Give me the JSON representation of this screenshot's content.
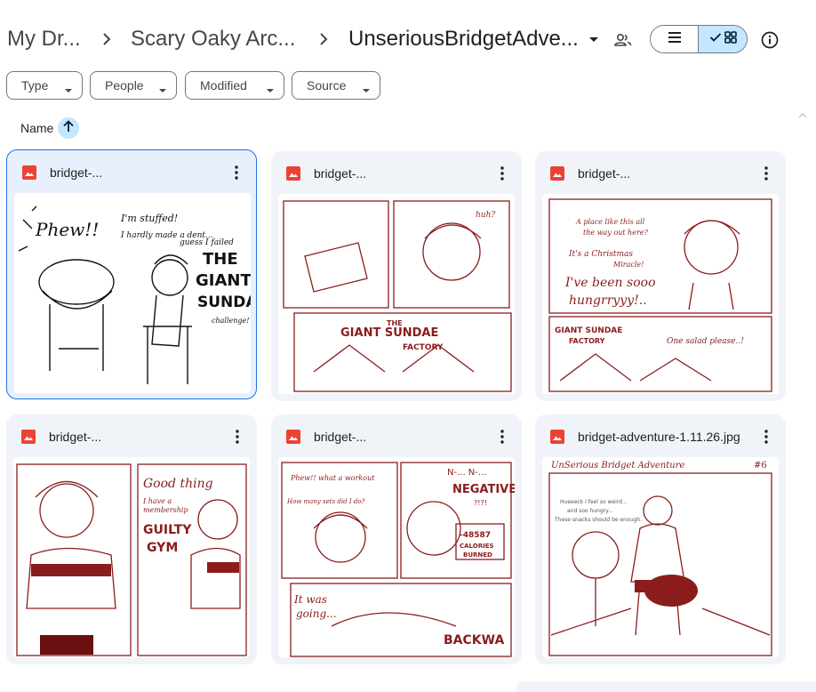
{
  "breadcrumb": {
    "items": [
      "My Dr...",
      "Scary Oaky Arc...",
      "UnseriousBridgetAdve..."
    ],
    "separator_icon": "chevron-right-icon",
    "current_dropdown_icon": "caret-down-icon",
    "shared_icon": "people-icon"
  },
  "view": {
    "list_icon": "list-icon",
    "grid_icon": "grid-icon",
    "selected": "grid",
    "selected_color": "#c2e7ff",
    "info_icon": "info-icon"
  },
  "filters": [
    "Type",
    "People",
    "Modified",
    "Source"
  ],
  "sort": {
    "label": "Name",
    "direction": "ascending",
    "icon": "arrow-up-icon"
  },
  "files": [
    {
      "name": "bridget-...",
      "icon": "image-icon",
      "selected": true
    },
    {
      "name": "bridget-...",
      "icon": "image-icon",
      "selected": false
    },
    {
      "name": "bridget-...",
      "icon": "image-icon",
      "selected": false
    },
    {
      "name": "bridget-...",
      "icon": "image-icon",
      "selected": false
    },
    {
      "name": "bridget-...",
      "icon": "image-icon",
      "selected": false
    },
    {
      "name": "bridget-adventure-1.11.26.jpg",
      "icon": "image-icon",
      "selected": false
    }
  ],
  "thumbnails": [
    {
      "texts": [
        "Phew!!",
        "I'm stuffed!",
        "I hardly made a dent...",
        "guess I failed",
        "THE",
        "GIANT",
        "SUNDA",
        "challenge!"
      ]
    },
    {
      "texts": [
        "huh?",
        "THE",
        "GIANT SUNDAE",
        "FACTORY"
      ]
    },
    {
      "texts": [
        "A place like this all",
        "the way out here?",
        "It's a Christmas",
        "Miracle!",
        "I've been sooo",
        "hungrryyy!..",
        "GIANT SUNDAE",
        "FACTORY",
        "One salad please..!"
      ]
    },
    {
      "texts": [
        "Good thing",
        "I have a",
        "membership",
        "GUILTY",
        "GYM"
      ]
    },
    {
      "texts": [
        "Phew!! what a workout",
        "How many sets did I do?",
        "N-... N-...",
        "NEGATIVE",
        "?!?!",
        "-48587",
        "CALORIES",
        "BURNED",
        "It was",
        "going...",
        "BACKWA"
      ]
    },
    {
      "texts": [
        "UnSerious Bridget Adventure",
        "#6",
        "Hueeeck I feel so weird...",
        "and soo hungry...",
        "These snacks should be enough."
      ]
    }
  ],
  "colors": {
    "accent": "#1a73e8",
    "selected_bg": "#c2e7ff",
    "card_bg": "#f0f4f9",
    "image_icon": "#ea4335",
    "sketch_ink": "#8a1c1c"
  }
}
